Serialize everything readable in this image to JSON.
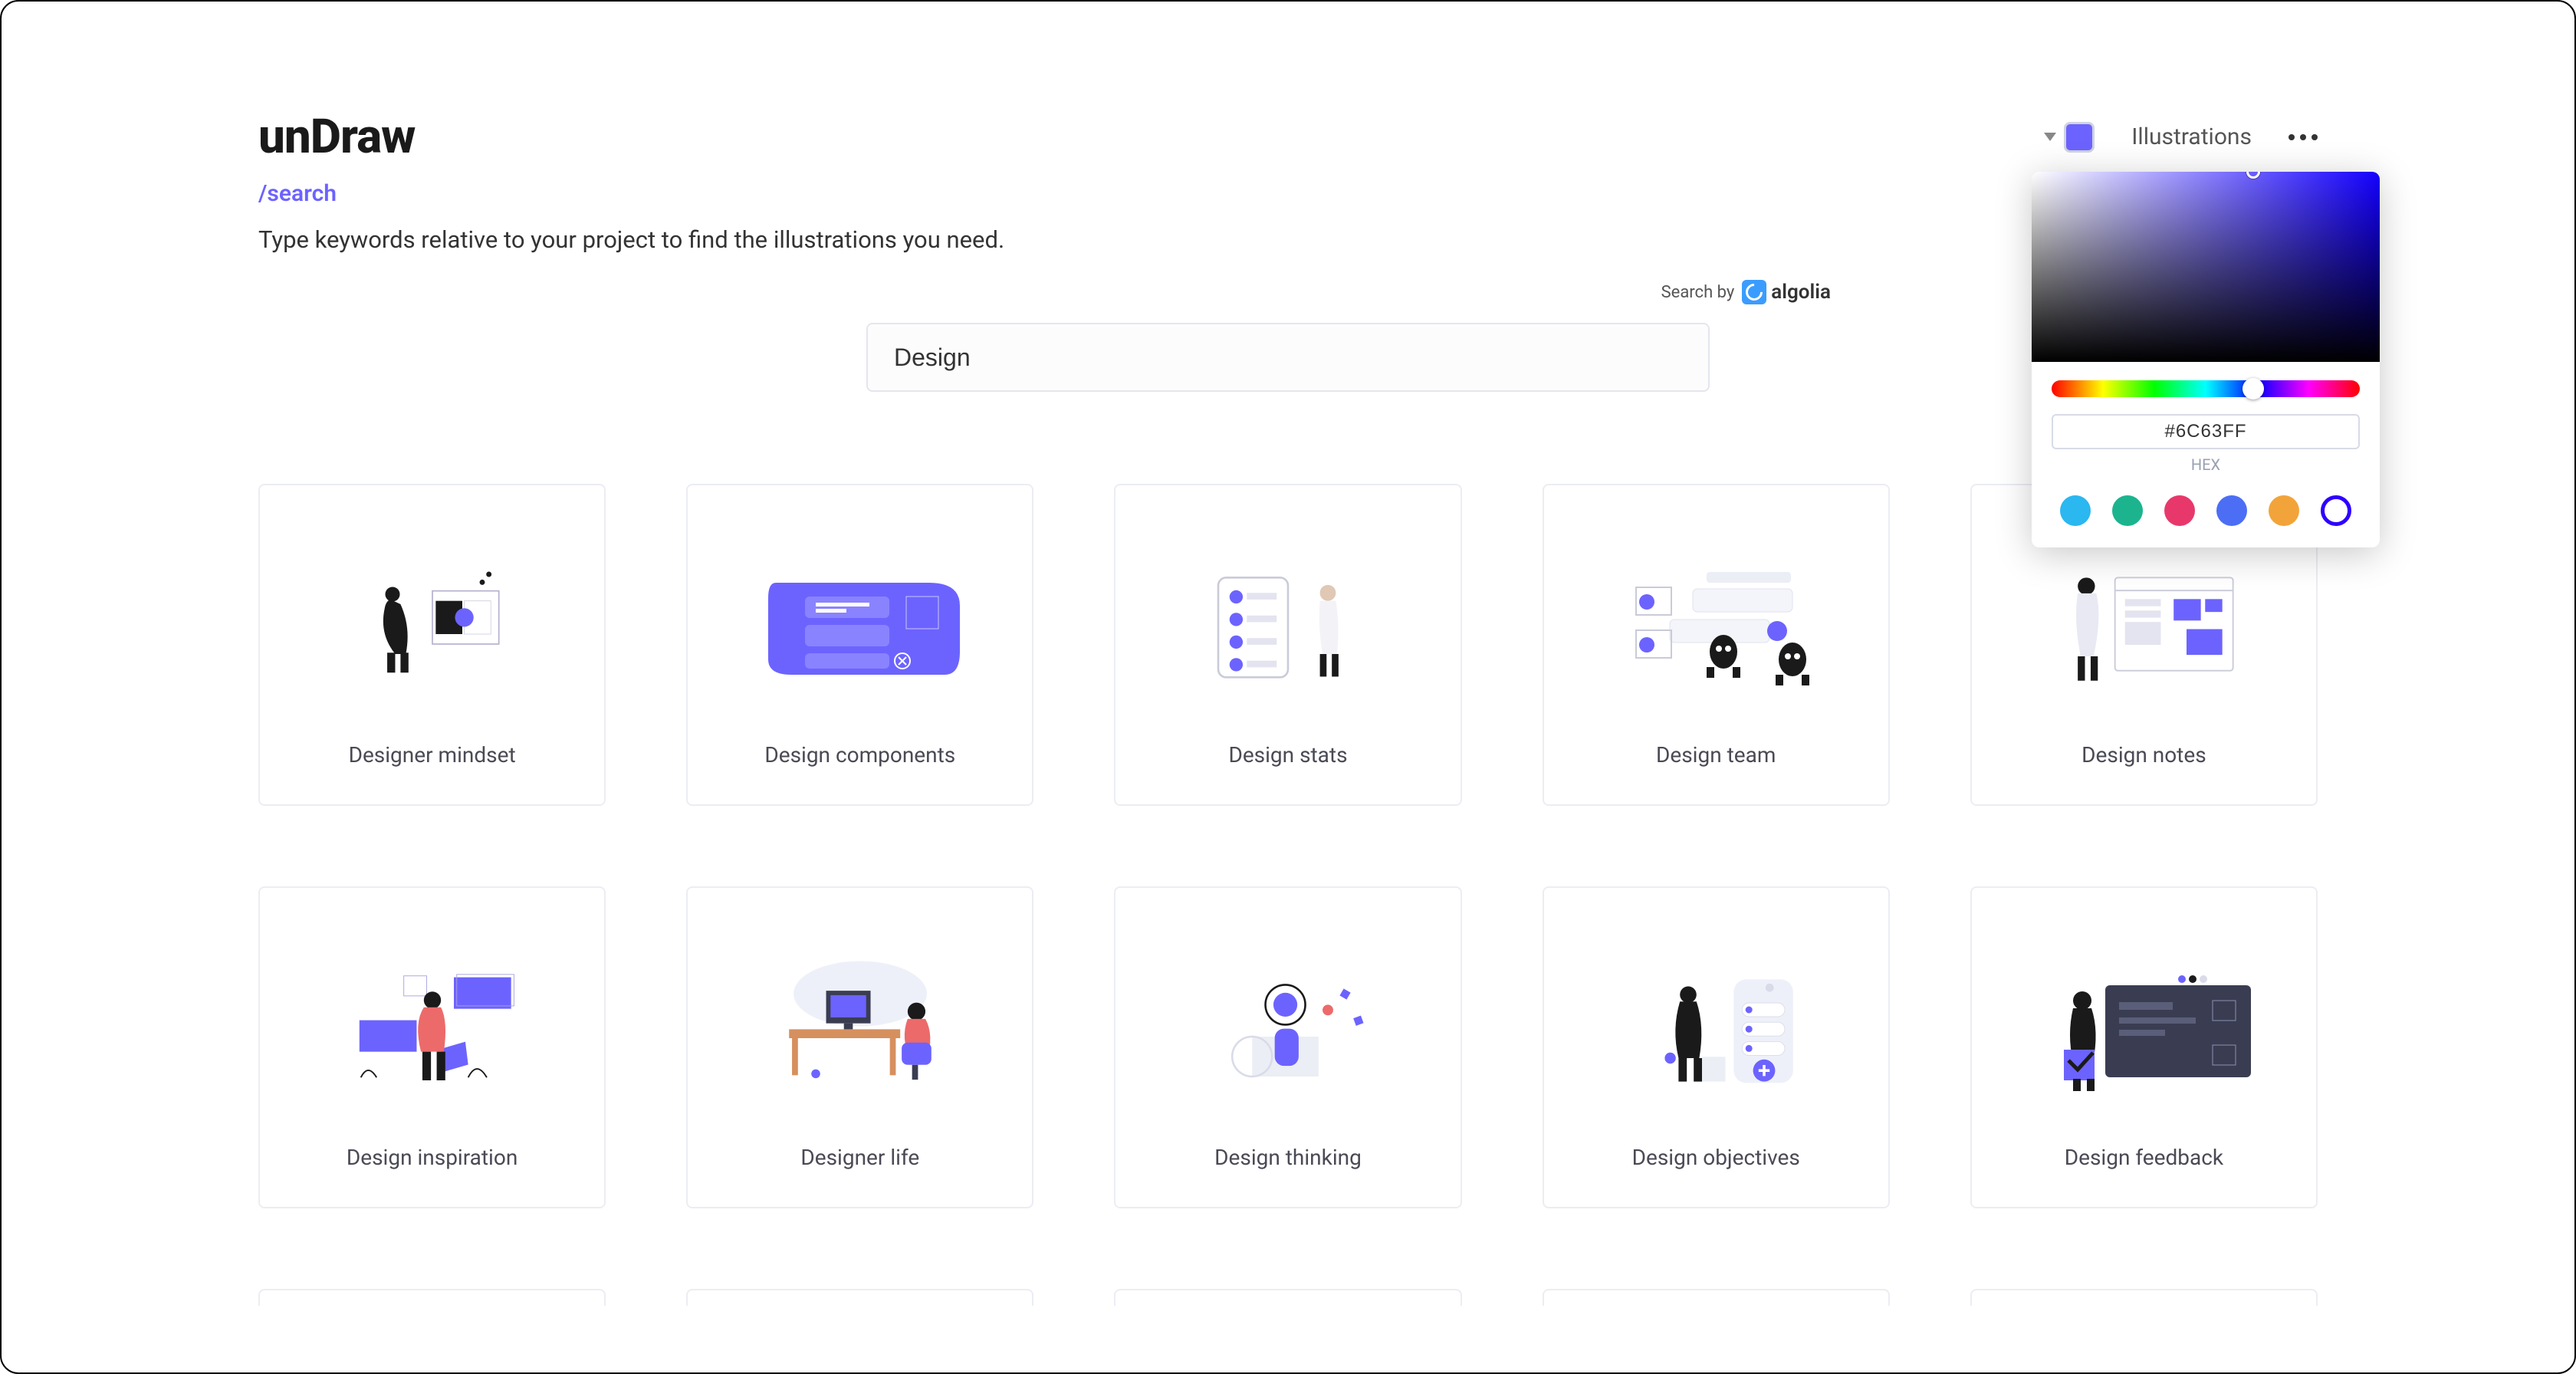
{
  "brand": {
    "logo": "unDraw"
  },
  "nav": {
    "illustrations": "Illustrations"
  },
  "page": {
    "breadcrumb": "/search",
    "subtitle": "Type keywords relative to your project to find the illustrations you need."
  },
  "search": {
    "powered_by_label": "Search by",
    "powered_by_provider": "algolia",
    "value": "Design"
  },
  "accent_color": "#6C63FF",
  "color_picker": {
    "hex_value": "#6C63FF",
    "hex_label": "HEX",
    "presets": [
      {
        "name": "blue",
        "hex": "#2bb7f0"
      },
      {
        "name": "teal",
        "hex": "#1cb48e"
      },
      {
        "name": "pink",
        "hex": "#e8386b"
      },
      {
        "name": "indigo",
        "hex": "#4c6ef5"
      },
      {
        "name": "orange",
        "hex": "#f2a43a"
      },
      {
        "name": "violet-ring",
        "hex": "#2e00ff"
      }
    ]
  },
  "results": [
    {
      "title": "Designer mindset"
    },
    {
      "title": "Design components"
    },
    {
      "title": "Design stats"
    },
    {
      "title": "Design team"
    },
    {
      "title": "Design notes"
    },
    {
      "title": "Design inspiration"
    },
    {
      "title": "Designer life"
    },
    {
      "title": "Design thinking"
    },
    {
      "title": "Design objectives"
    },
    {
      "title": "Design feedback"
    }
  ]
}
